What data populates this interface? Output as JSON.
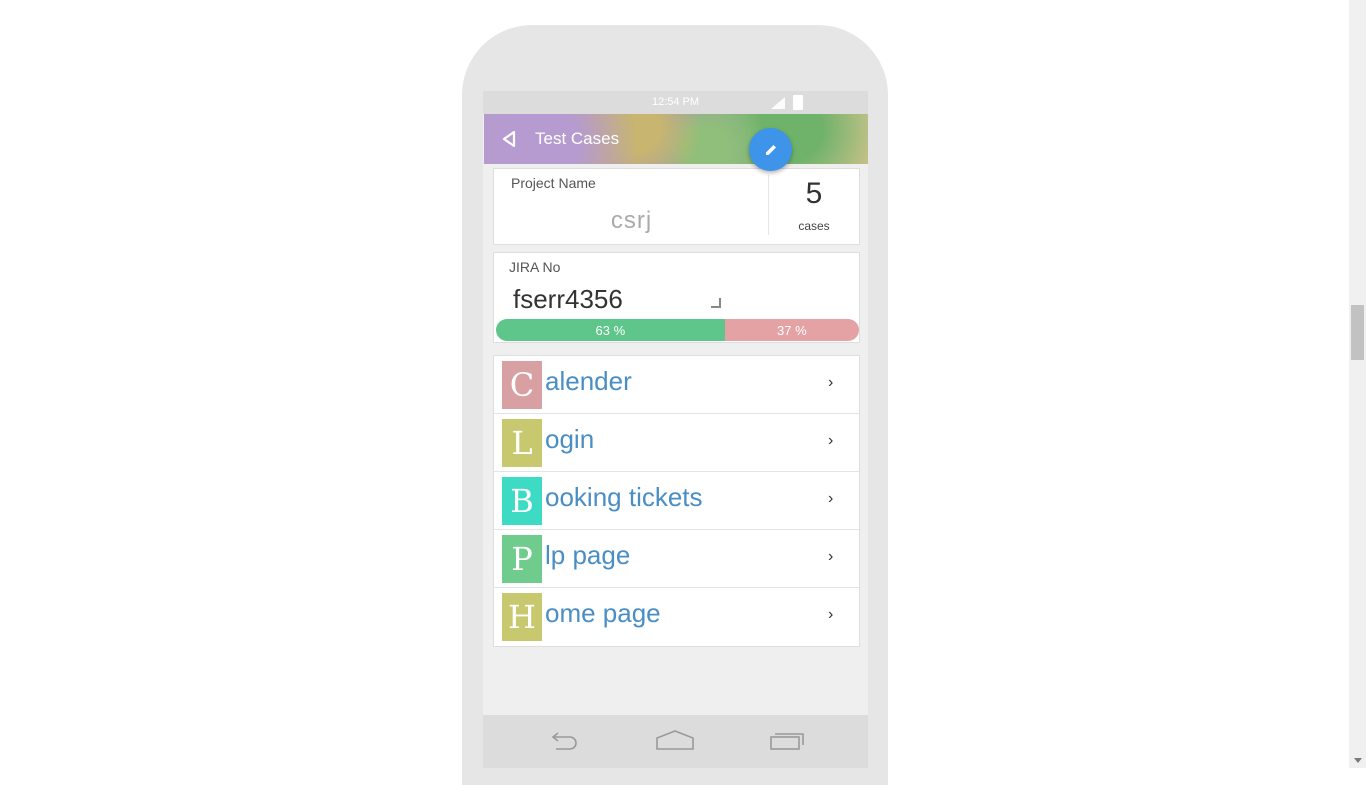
{
  "status_bar": {
    "time": "12:54 PM"
  },
  "app_bar": {
    "title": "Test Cases",
    "back_icon": "back-triangle-icon",
    "fab_icon": "pencil-icon"
  },
  "project_card": {
    "label": "Project Name",
    "value": "csrj",
    "count": "5",
    "count_label": "cases"
  },
  "jira_card": {
    "label": "JIRA No",
    "value": "fserr4356"
  },
  "progress": {
    "pass_percent": 63,
    "pass_label": "63 %",
    "fail_percent": 37,
    "fail_label": "37 %"
  },
  "test_cases": [
    {
      "initial": "C",
      "rest": "alender",
      "color": "#d8a0a3"
    },
    {
      "initial": "L",
      "rest": "ogin",
      "color": "#c8c96e"
    },
    {
      "initial": "B",
      "rest": "ooking tickets",
      "color": "#3ddbc3"
    },
    {
      "initial": "P",
      "rest": "lp page",
      "color": "#6fcc8c"
    },
    {
      "initial": "H",
      "rest": "ome page",
      "color": "#c8c96e"
    }
  ],
  "chevron": "›",
  "nav_bar": {
    "icons": [
      "back-arrow-icon",
      "home-icon",
      "recent-apps-icon"
    ]
  }
}
